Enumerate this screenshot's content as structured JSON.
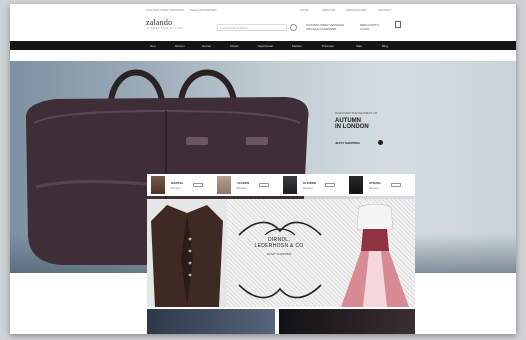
{
  "header": {
    "util_left": [
      "KOSTENLOSER VERSAND",
      "ZAHLUNGSARTEN"
    ],
    "util_right": [
      "HILFE",
      "SERVICE",
      "NEWSLETTER",
      "KONTAKT"
    ],
    "logo": "zalando",
    "logo_tag": "SCHREI VOR GLÜCK",
    "search_placeholder": "Suchbegriff eingeben",
    "promo_lines": [
      "KOSTENLOSER VERSAND",
      "UND RÜCKVERSAND"
    ],
    "account_lines": [
      "MEIN KONTO",
      "LOGIN"
    ]
  },
  "nav": [
    "Neu",
    "Damen",
    "Herren",
    "Kinder",
    "Sportswear",
    "Marken",
    "Premium",
    "Sale",
    "Blog"
  ],
  "hero": {
    "eyebrow": "DISCOVER THE SECRETS OF",
    "title": "AUTUMN\nIN LONDON",
    "cta": "JETZT SHOPPEN"
  },
  "strip": [
    {
      "label": "MÄNTEL",
      "sub": "Damen"
    },
    {
      "label": "JACKEN",
      "sub": "Damen"
    },
    {
      "label": "KLEIDER",
      "sub": "Damen"
    },
    {
      "label": "STIEFEL",
      "sub": "Damen"
    }
  ],
  "banner": {
    "title": "DIRNDL,\nLEDERHOSN & CO",
    "cta": "JETZT SHOPPEN"
  },
  "colors": {
    "nav_bg": "#151515",
    "bag": "#3e2f36",
    "dirndl_pink": "#d98b95"
  }
}
